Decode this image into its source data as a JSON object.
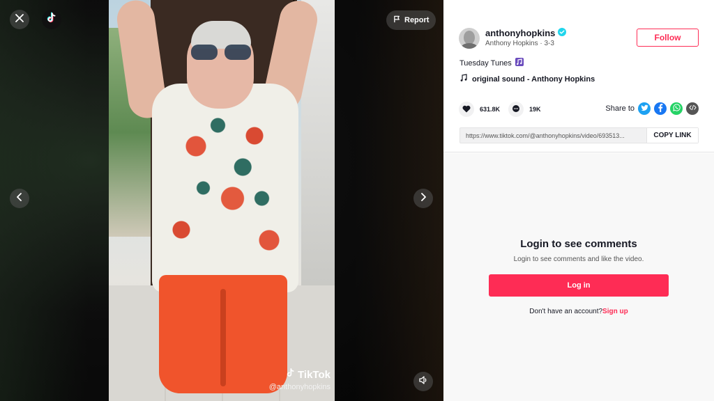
{
  "video": {
    "report_label": "Report",
    "watermark_brand": "TikTok",
    "watermark_user": "@anthonyhopkins"
  },
  "author": {
    "username": "anthonyhopkins",
    "display_name": "Anthony Hopkins",
    "date": "3-3",
    "verified": true,
    "follow_label": "Follow"
  },
  "post": {
    "caption": "Tuesday Tunes",
    "sound": "original sound - Anthony Hopkins",
    "likes": "631.8K",
    "comments": "19K"
  },
  "share": {
    "label": "Share to",
    "link": "https://www.tiktok.com/@anthonyhopkins/video/693513...",
    "copy_label": "COPY LINK"
  },
  "comments": {
    "title": "Login to see comments",
    "subtitle": "Login to see comments and like the video.",
    "login_label": "Log in",
    "no_account": "Don't have an account?",
    "signup_label": "Sign up"
  },
  "colors": {
    "accent": "#fe2c55",
    "verified": "#20d5ec",
    "twitter": "#1da1f2",
    "facebook": "#1877f2",
    "whatsapp": "#25d366"
  }
}
